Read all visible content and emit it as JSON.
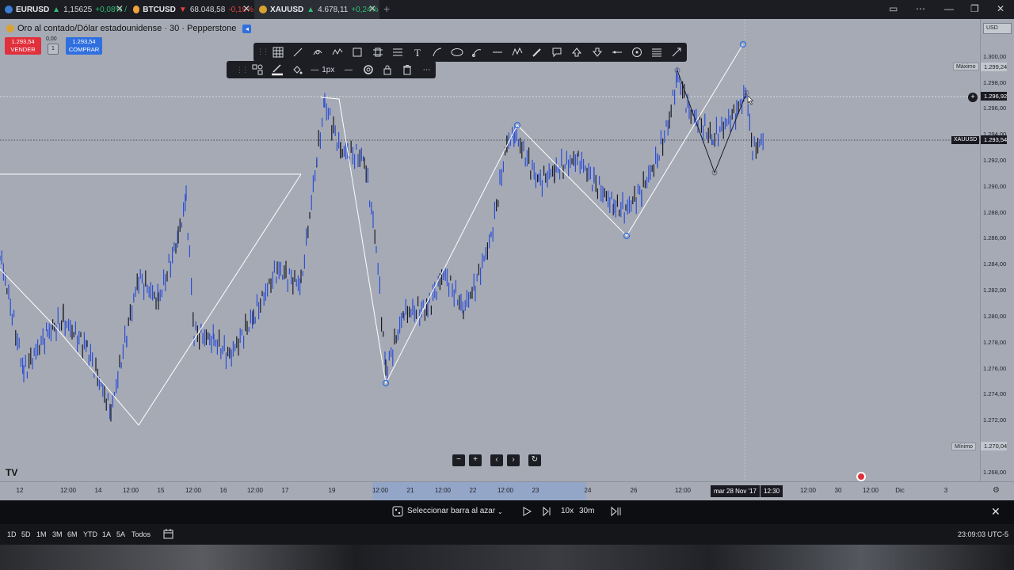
{
  "tabs": [
    {
      "symbol": "EURUSD",
      "price": "1,15625",
      "change": "+0,08% /",
      "dir": "up",
      "coin_color": "#3a7bd5"
    },
    {
      "symbol": "BTCUSD",
      "price": "68.048,58",
      "change": "-0,19%",
      "dir": "down",
      "coin_color": "#f2a33a"
    },
    {
      "symbol": "XAUUSD",
      "price": "4.678,11",
      "change": "+0,24%",
      "dir": "up",
      "coin_color": "#d8a330"
    }
  ],
  "chart": {
    "title": "Oro al contado/Dólar estadounidense · 30 · Pepperstone",
    "sell_price": "1.293,54",
    "sell_label": "VENDER",
    "buy_price": "1.293,54",
    "buy_label": "COMPRAR",
    "spread_value": "0,00",
    "spread_box": "1",
    "currency_button": "USD",
    "stroke_width": "1px",
    "high_label": "Máximo",
    "high_value": "1.299,24",
    "low_label": "Mínimo",
    "low_value": "1.270,04",
    "crosshair_value": "1.296,92",
    "symbol_tag": "XAUUSD",
    "last_price": "1.293,54",
    "crosshair_date": "mar 28 Nov '17",
    "crosshair_time": "12:30",
    "watermark": "TV"
  },
  "price_axis": [
    "1.300,00",
    "1.298,00",
    "1.296,00",
    "1.294,00",
    "1.292,00",
    "1.290,00",
    "1.288,00",
    "1.286,00",
    "1.284,00",
    "1.282,00",
    "1.280,00",
    "1.278,00",
    "1.276,00",
    "1.274,00",
    "1.272,00",
    "1.268,00"
  ],
  "time_axis": [
    "12",
    "12:00",
    "14",
    "12:00",
    "15",
    "12:00",
    "16",
    "12:00",
    "17",
    "19",
    "12:00",
    "21",
    "12:00",
    "22",
    "12:00",
    "23",
    "24",
    "26",
    "12:00",
    "12:00",
    "30",
    "12:00",
    "Dic",
    "3"
  ],
  "replay": {
    "select_bar": "Seleccionar barra al azar",
    "speed": "10x",
    "interval": "30m"
  },
  "ranges": [
    "1D",
    "5D",
    "1M",
    "3M",
    "6M",
    "YTD",
    "1A",
    "5A",
    "Todos"
  ],
  "clock": "23:09:03 UTC-5",
  "colors": {
    "chart_bg": "#a6aab5",
    "candle_blue": "#2c4fd6",
    "candle_dark": "#1a1b22",
    "sell": "#e0303c",
    "buy": "#2f6fe0"
  }
}
